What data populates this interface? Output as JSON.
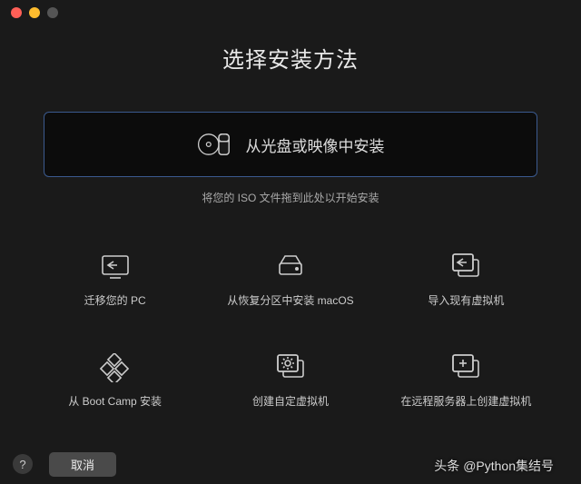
{
  "title": "选择安装方法",
  "primary": {
    "label": "从光盘或映像中安装",
    "subtitle": "将您的 ISO 文件拖到此处以开始安装"
  },
  "options": [
    {
      "label": "迁移您的 PC"
    },
    {
      "label": "从恢复分区中安装 macOS"
    },
    {
      "label": "导入现有虚拟机"
    },
    {
      "label": "从 Boot Camp 安装"
    },
    {
      "label": "创建自定虚拟机"
    },
    {
      "label": "在远程服务器上创建虚拟机"
    }
  ],
  "footer": {
    "help": "?",
    "cancel": "取消"
  },
  "watermark": {
    "prefix": "头条",
    "author": "@Python集结号"
  }
}
